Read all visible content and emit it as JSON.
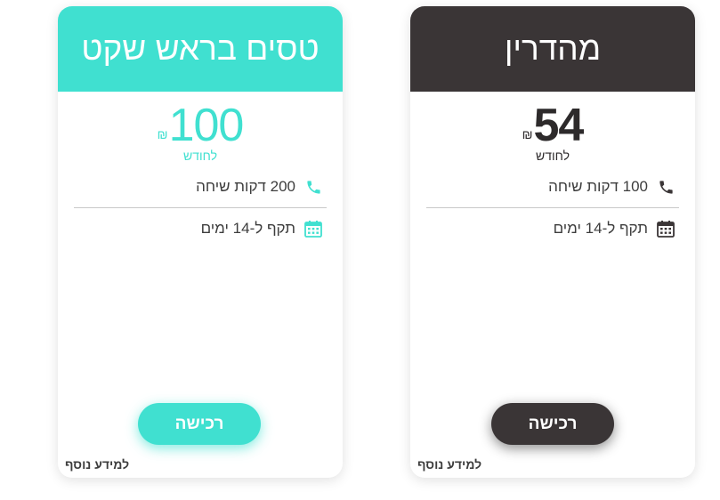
{
  "plans": [
    {
      "title": "טסים בראש שקט",
      "currency": "₪",
      "price": "100",
      "period": "לחודש",
      "features": [
        "200 דקות שיחה",
        "תקף ל-14 ימים"
      ],
      "button_label": "רכישה",
      "more_info": "למידע נוסף",
      "accent_color": "#40e0d0"
    },
    {
      "title": "מהדרין",
      "currency": "₪",
      "price": "54",
      "period": "לחודש",
      "features": [
        "100 דקות שיחה",
        "תקף ל-14 ימים"
      ],
      "button_label": "רכישה",
      "more_info": "למידע נוסף",
      "accent_color": "#3a3536"
    }
  ],
  "icons": {
    "feature_1": "phone-icon",
    "feature_2": "calendar-icon"
  }
}
